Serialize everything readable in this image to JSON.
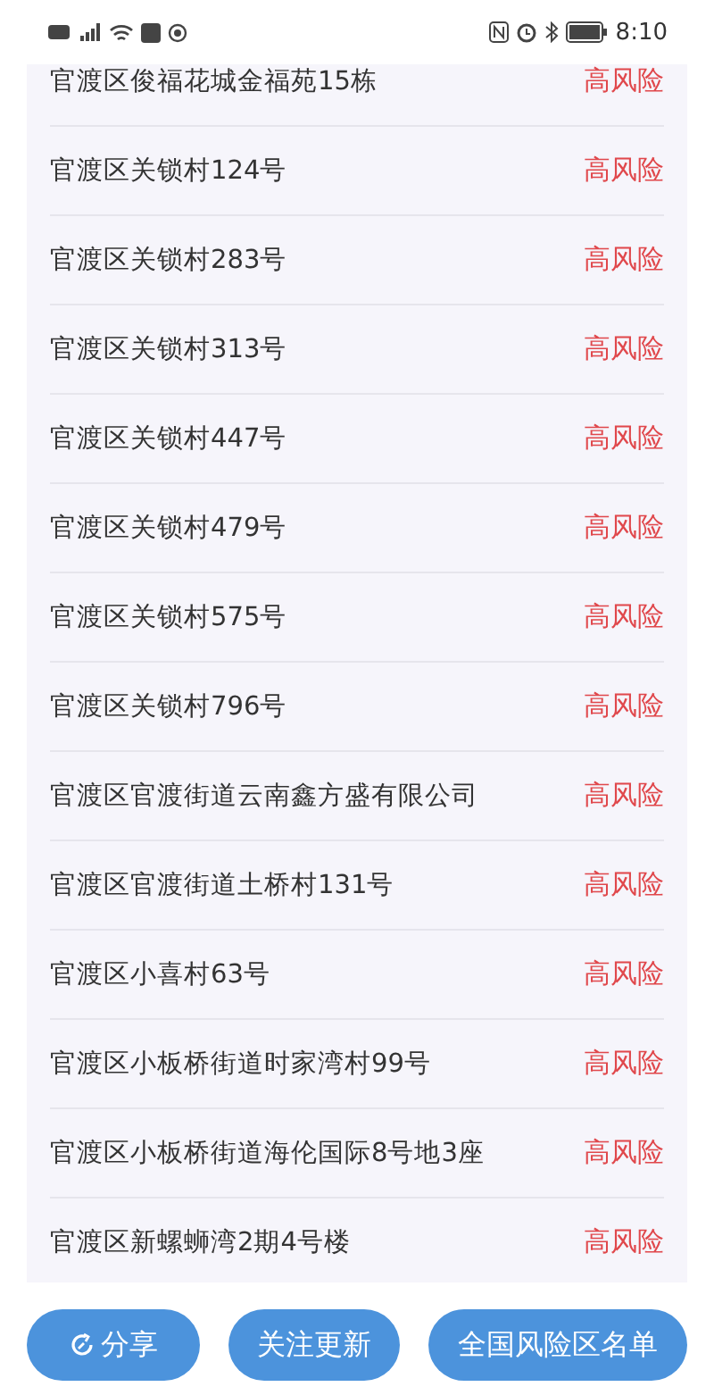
{
  "status_bar": {
    "time": "8:10"
  },
  "areas": [
    {
      "name": "官渡区俊福花城金福苑15栋",
      "risk": "高风险"
    },
    {
      "name": "官渡区关锁村124号",
      "risk": "高风险"
    },
    {
      "name": "官渡区关锁村283号",
      "risk": "高风险"
    },
    {
      "name": "官渡区关锁村313号",
      "risk": "高风险"
    },
    {
      "name": "官渡区关锁村447号",
      "risk": "高风险"
    },
    {
      "name": "官渡区关锁村479号",
      "risk": "高风险"
    },
    {
      "name": "官渡区关锁村575号",
      "risk": "高风险"
    },
    {
      "name": "官渡区关锁村796号",
      "risk": "高风险"
    },
    {
      "name": "官渡区官渡街道云南鑫方盛有限公司",
      "risk": "高风险"
    },
    {
      "name": "官渡区官渡街道土桥村131号",
      "risk": "高风险"
    },
    {
      "name": "官渡区小喜村63号",
      "risk": "高风险"
    },
    {
      "name": "官渡区小板桥街道时家湾村99号",
      "risk": "高风险"
    },
    {
      "name": "官渡区小板桥街道海伦国际8号地3座",
      "risk": "高风险"
    },
    {
      "name": "官渡区新螺蛳湾2期4号楼",
      "risk": "高风险"
    }
  ],
  "buttons": [
    {
      "label": "分享",
      "kind": "share"
    },
    {
      "label": "关注更新",
      "kind": "plain"
    },
    {
      "label": "全国风险区名单",
      "kind": "plain"
    }
  ]
}
